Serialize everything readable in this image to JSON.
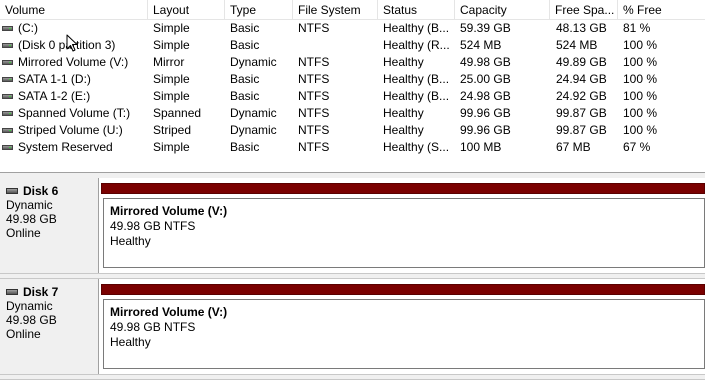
{
  "volume_list": {
    "columns": [
      "Volume",
      "Layout",
      "Type",
      "File System",
      "Status",
      "Capacity",
      "Free Spa...",
      "% Free"
    ],
    "rows": [
      {
        "volume": " (C:)",
        "layout": "Simple",
        "type": "Basic",
        "fs": "NTFS",
        "status": "Healthy (B...",
        "capacity": "59.39 GB",
        "free": "48.13 GB",
        "pct": "81 %"
      },
      {
        "volume": "(Disk 0 partition 3)",
        "layout": "Simple",
        "type": "Basic",
        "fs": "",
        "status": "Healthy (R...",
        "capacity": "524 MB",
        "free": "524 MB",
        "pct": "100 %"
      },
      {
        "volume": "Mirrored Volume (V:)",
        "layout": "Mirror",
        "type": "Dynamic",
        "fs": "NTFS",
        "status": "Healthy",
        "capacity": "49.98 GB",
        "free": "49.89 GB",
        "pct": "100 %"
      },
      {
        "volume": "SATA 1-1 (D:)",
        "layout": "Simple",
        "type": "Basic",
        "fs": "NTFS",
        "status": "Healthy (B...",
        "capacity": "25.00 GB",
        "free": "24.94 GB",
        "pct": "100 %"
      },
      {
        "volume": "SATA 1-2 (E:)",
        "layout": "Simple",
        "type": "Basic",
        "fs": "NTFS",
        "status": "Healthy (B...",
        "capacity": "24.98 GB",
        "free": "24.92 GB",
        "pct": "100 %"
      },
      {
        "volume": "Spanned Volume (T:)",
        "layout": "Spanned",
        "type": "Dynamic",
        "fs": "NTFS",
        "status": "Healthy",
        "capacity": "99.96 GB",
        "free": "99.87 GB",
        "pct": "100 %"
      },
      {
        "volume": "Striped Volume (U:)",
        "layout": "Striped",
        "type": "Dynamic",
        "fs": "NTFS",
        "status": "Healthy",
        "capacity": "99.96 GB",
        "free": "99.87 GB",
        "pct": "100 %"
      },
      {
        "volume": "System Reserved",
        "layout": "Simple",
        "type": "Basic",
        "fs": "NTFS",
        "status": "Healthy (S...",
        "capacity": "100 MB",
        "free": "67 MB",
        "pct": "67 %"
      }
    ]
  },
  "disks": [
    {
      "name": "Disk 6",
      "type": "Dynamic",
      "size": "49.98 GB",
      "state": "Online",
      "partition": {
        "name": "Mirrored Volume  (V:)",
        "size_fs": "49.98 GB NTFS",
        "status": "Healthy"
      }
    },
    {
      "name": "Disk 7",
      "type": "Dynamic",
      "size": "49.98 GB",
      "state": "Online",
      "partition": {
        "name": "Mirrored Volume  (V:)",
        "size_fs": "49.98 GB NTFS",
        "status": "Healthy"
      }
    }
  ],
  "icons": {
    "volume": "volume-drive-icon",
    "disk": "disk-drive-icon",
    "cursor": "mouse-pointer-icon"
  },
  "colors": {
    "mirrored_bar": "#7a0000",
    "panel_bg": "#f0f0f0"
  }
}
